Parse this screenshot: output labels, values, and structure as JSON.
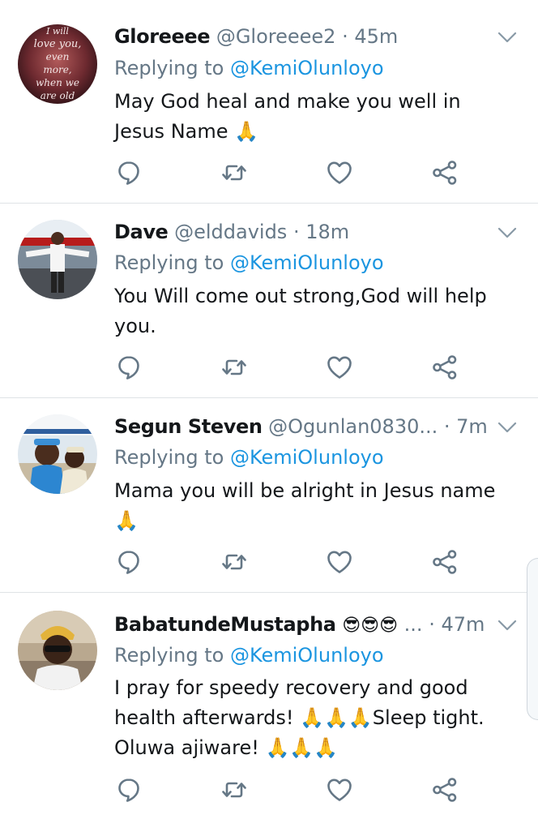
{
  "colors": {
    "accent": "#1b95e0",
    "muted": "#657786",
    "text": "#14171a",
    "divider": "#dfe3e6"
  },
  "replies": [
    {
      "name": "Gloreeee",
      "handle": "@Gloreeee2",
      "time": "· 45m",
      "replying_prefix": "Replying to ",
      "replying_to": "@KemiOlunloyo",
      "text": "May God heal and make you well in Jesus Name 🙏",
      "avatar_caption": "I will love you, even more, when we are old",
      "icons": [
        "reply-icon",
        "retweet-icon",
        "like-icon",
        "share-icon",
        "chevron-down-icon"
      ]
    },
    {
      "name": "Dave",
      "handle": "@elddavids",
      "time": "· 18m",
      "replying_prefix": "Replying to ",
      "replying_to": "@KemiOlunloyo",
      "text": "You Will come out strong,God will help you.",
      "icons": [
        "reply-icon",
        "retweet-icon",
        "like-icon",
        "share-icon",
        "chevron-down-icon"
      ]
    },
    {
      "name": "Segun Steven",
      "handle": "@Ogunlan0830...",
      "time": "· 7m",
      "replying_prefix": "Replying to ",
      "replying_to": "@KemiOlunloyo",
      "text": "Mama you will be alright in Jesus name 🙏",
      "icons": [
        "reply-icon",
        "retweet-icon",
        "like-icon",
        "share-icon",
        "chevron-down-icon"
      ]
    },
    {
      "name": "BabatundeMustapha",
      "name_emoji": "😎😎😎",
      "handle": "...",
      "time": "· 47m",
      "replying_prefix": "Replying to ",
      "replying_to": "@KemiOlunloyo",
      "text": "I pray for speedy recovery and good health afterwards! 🙏🙏🙏Sleep tight. Oluwa ajiware! 🙏🙏🙏",
      "icons": [
        "reply-icon",
        "retweet-icon",
        "like-icon",
        "share-icon",
        "chevron-down-icon"
      ]
    }
  ]
}
